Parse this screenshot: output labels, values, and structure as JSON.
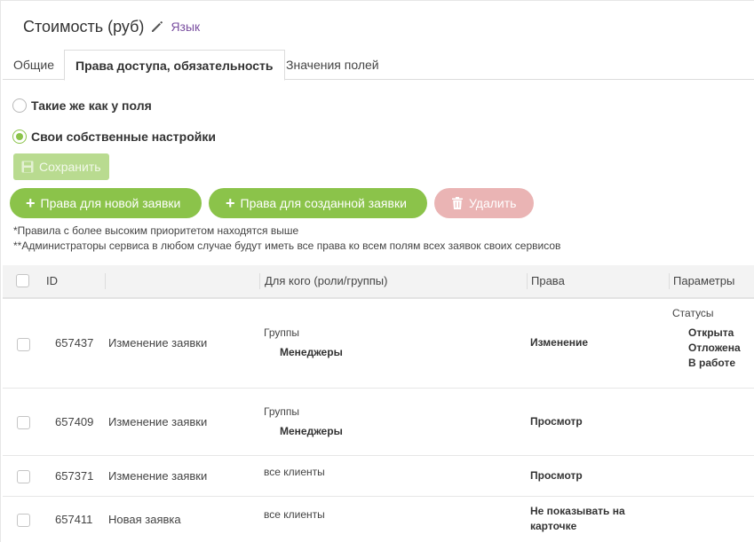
{
  "header": {
    "title": "Стоимость (руб)",
    "lang_link": "Язык"
  },
  "tabs": [
    {
      "label": "Общие",
      "active": false
    },
    {
      "label": "Права доступа, обязательность",
      "active": true
    },
    {
      "label": "Значения полей",
      "active": false
    }
  ],
  "options": {
    "same_as_field": {
      "label": "Такие же как у поля",
      "checked": false
    },
    "own_settings": {
      "label": "Свои собственные настройки",
      "checked": true
    }
  },
  "buttons": {
    "save": "Сохранить",
    "new_request_rights": "Права для новой заявки",
    "created_request_rights": "Права для созданной заявки",
    "delete": "Удалить"
  },
  "notes": {
    "priority": "*Правила с более высоким приоритетом находятся выше",
    "admins": "**Администраторы сервиса в любом случае будут иметь все права ко всем полям всех заявок своих сервисов"
  },
  "table": {
    "columns": {
      "id": "ID",
      "name": "",
      "for_whom": "Для кого (роли/группы)",
      "rights": "Права",
      "params": "Параметры"
    },
    "rows": [
      {
        "id": "657437",
        "name": "Изменение заявки",
        "who_label": "Группы",
        "who_value": "Менеджеры",
        "rights": [
          "Изменение"
        ],
        "params_label": "Статусы",
        "params_values": [
          "Открыта",
          "Отложена",
          "В работе"
        ]
      },
      {
        "id": "657409",
        "name": "Изменение заявки",
        "who_label": "Группы",
        "who_value": "Менеджеры",
        "rights": [
          "Просмотр"
        ],
        "params_label": "",
        "params_values": []
      },
      {
        "id": "657371",
        "name": "Изменение заявки",
        "who_label": "все клиенты",
        "who_value": "",
        "rights": [
          "Просмотр"
        ],
        "params_label": "",
        "params_values": []
      },
      {
        "id": "657411",
        "name": "Новая заявка",
        "who_label": "все клиенты",
        "who_value": "",
        "rights": [
          "Не показывать на",
          "карточке"
        ],
        "params_label": "",
        "params_values": []
      }
    ]
  },
  "colors": {
    "accent_green": "#8bc34a",
    "save_disabled": "#b9db90",
    "delete_disabled": "#eab4b4",
    "link_purple": "#7a4fa0"
  }
}
